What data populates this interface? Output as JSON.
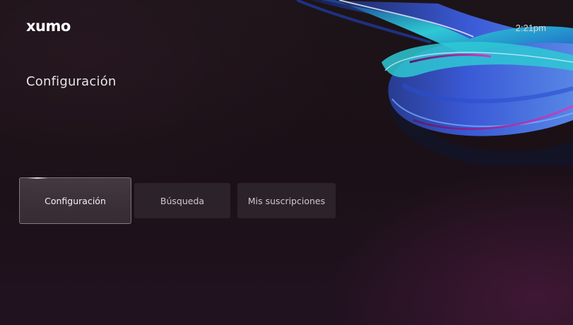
{
  "header": {
    "brand": "xumo",
    "clock": "2:21pm"
  },
  "page": {
    "title": "Configuración"
  },
  "tabs": [
    {
      "label": "Configuración",
      "active": true
    },
    {
      "label": "Búsqueda",
      "active": false
    },
    {
      "label": "Mis suscripciones",
      "active": false
    }
  ],
  "colors": {
    "background": "#1a1016",
    "ribbon_teal": "#2ec9d4",
    "ribbon_blue": "#3c5de0",
    "ribbon_magenta": "#d43cc8",
    "ribbon_white": "#e8f4ff"
  }
}
